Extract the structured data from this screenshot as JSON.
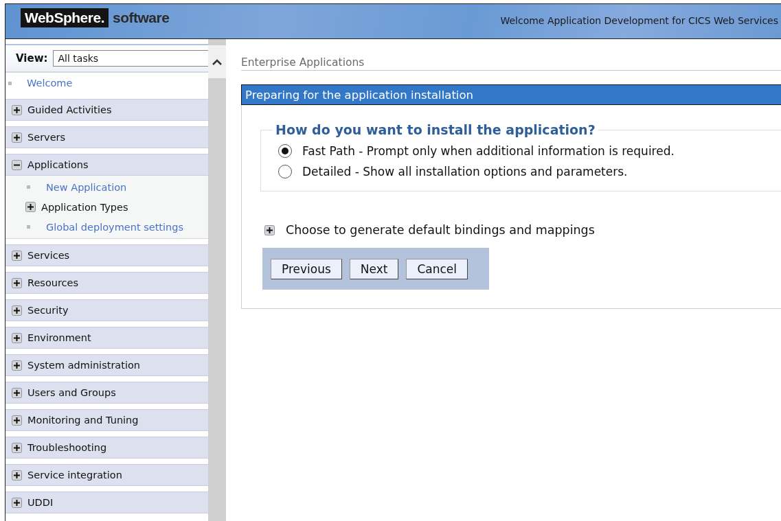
{
  "header": {
    "logo_mark": "WebSphere.",
    "logo_text": "software",
    "welcome": "Welcome Application Development for CICS Web Services"
  },
  "sidebar": {
    "view_label": "View:",
    "view_value": "All tasks",
    "items": [
      {
        "kind": "link",
        "label": "Welcome"
      },
      {
        "kind": "section",
        "label": "Guided Activities",
        "expanded": false
      },
      {
        "kind": "section",
        "label": "Servers",
        "expanded": false
      },
      {
        "kind": "section",
        "label": "Applications",
        "expanded": true,
        "children": [
          {
            "kind": "link",
            "label": "New Application"
          },
          {
            "kind": "group",
            "label": "Application Types",
            "expanded": false
          },
          {
            "kind": "link",
            "label": "Global deployment settings"
          }
        ]
      },
      {
        "kind": "section",
        "label": "Services",
        "expanded": false
      },
      {
        "kind": "section",
        "label": "Resources",
        "expanded": false
      },
      {
        "kind": "section",
        "label": "Security",
        "expanded": false
      },
      {
        "kind": "section",
        "label": "Environment",
        "expanded": false
      },
      {
        "kind": "section",
        "label": "System administration",
        "expanded": false
      },
      {
        "kind": "section",
        "label": "Users and Groups",
        "expanded": false
      },
      {
        "kind": "section",
        "label": "Monitoring and Tuning",
        "expanded": false
      },
      {
        "kind": "section",
        "label": "Troubleshooting",
        "expanded": false
      },
      {
        "kind": "section",
        "label": "Service integration",
        "expanded": false
      },
      {
        "kind": "section",
        "label": "UDDI",
        "expanded": false
      }
    ]
  },
  "content": {
    "breadcrumb": "Enterprise Applications",
    "panel_title": "Preparing for the application installation",
    "question": "How do you want to install the application?",
    "options": [
      {
        "label": "Fast Path - Prompt only when additional information is required.",
        "selected": true
      },
      {
        "label": "Detailed - Show all installation options and parameters.",
        "selected": false
      }
    ],
    "bindings": {
      "label": "Choose to generate default bindings and mappings",
      "expanded": false
    },
    "buttons": [
      "Previous",
      "Next",
      "Cancel"
    ]
  }
}
